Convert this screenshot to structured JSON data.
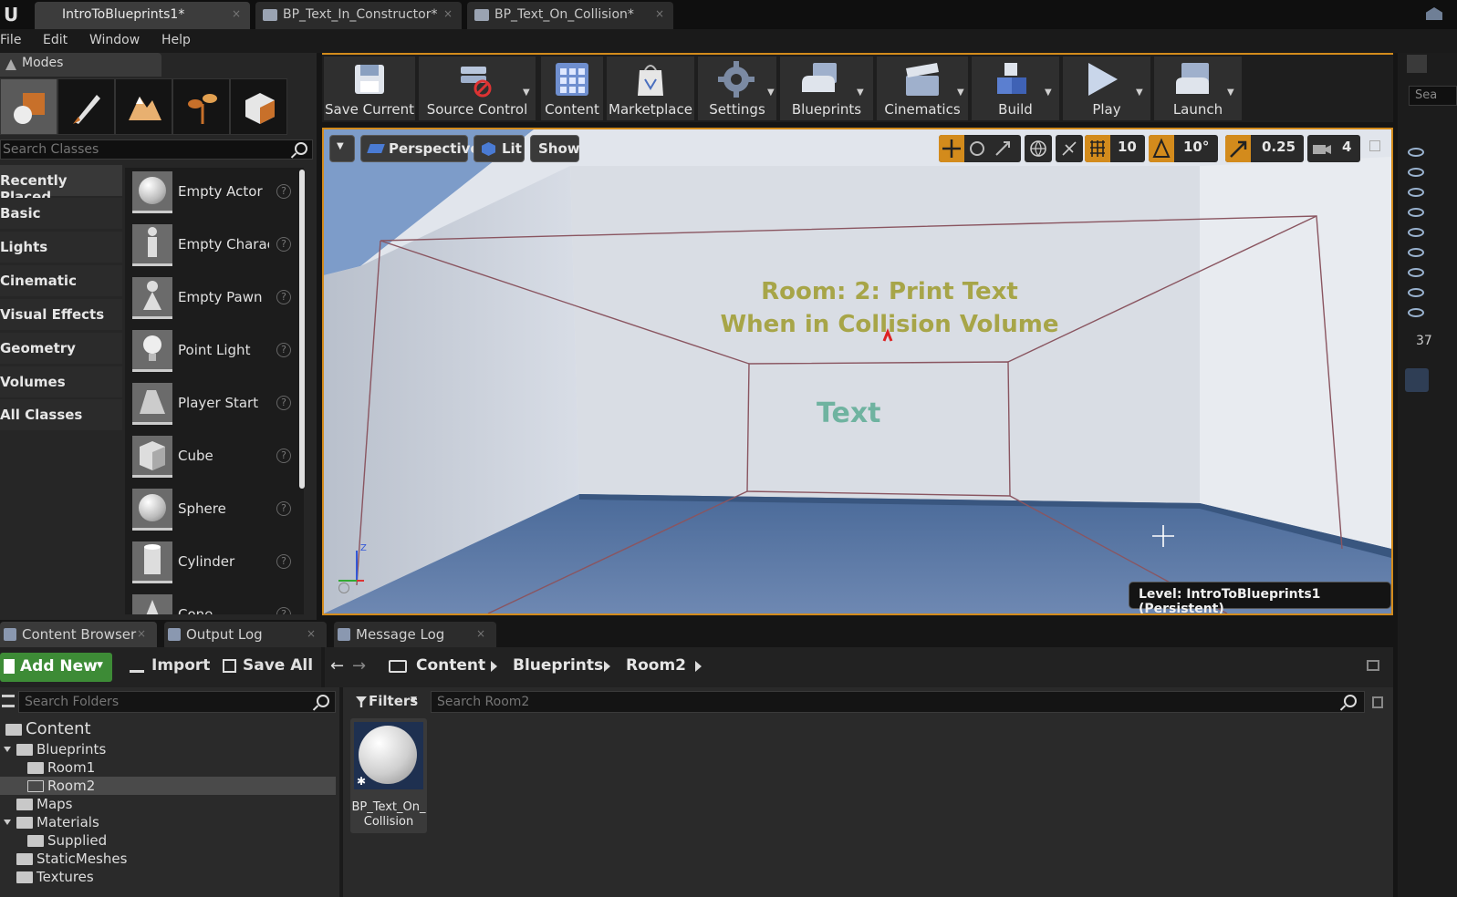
{
  "window": {
    "tabs": [
      {
        "label": "IntroToBlueprints1*"
      },
      {
        "label": "BP_Text_In_Constructor*"
      },
      {
        "label": "BP_Text_On_Collision*"
      }
    ]
  },
  "menu": [
    "File",
    "Edit",
    "Window",
    "Help"
  ],
  "modes": {
    "tab_label": "Modes",
    "search_placeholder": "Search Classes",
    "categories": [
      "Recently Placed",
      "Basic",
      "Lights",
      "Cinematic",
      "Visual Effects",
      "Geometry",
      "Volumes",
      "All Classes"
    ],
    "items": [
      "Empty Actor",
      "Empty Charac",
      "Empty Pawn",
      "Point Light",
      "Player Start",
      "Cube",
      "Sphere",
      "Cylinder",
      "Cone"
    ]
  },
  "toolbar": {
    "buttons": [
      "Save Current",
      "Source Control",
      "Content",
      "Marketplace",
      "Settings",
      "Blueprints",
      "Cinematics",
      "Build",
      "Play",
      "Launch"
    ]
  },
  "viewport": {
    "perspective": "Perspective",
    "lit": "Lit",
    "show": "Show",
    "grid_snap": "10",
    "rotation_snap": "10°",
    "scale_snap": "0.25",
    "camera_speed": "4",
    "room_text_line1": "Room: 2: Print Text",
    "room_text_line2": "When in Collision Volume",
    "text_actor": "Text",
    "level_label": "Level:  IntroToBlueprints1 (Persistent)"
  },
  "right_strip": {
    "search_stub": "Sea",
    "count_stub": "37"
  },
  "bottom_tabs": [
    "Content Browser",
    "Output Log",
    "Message Log"
  ],
  "content_browser": {
    "add_new": "Add New",
    "import": "Import",
    "save_all": "Save All",
    "breadcrumb": [
      "Content",
      "Blueprints",
      "Room2"
    ],
    "folder_search_placeholder": "Search Folders",
    "filters": "Filters",
    "asset_search_placeholder": "Search Room2",
    "tree": [
      "Content",
      "Blueprints",
      "Room1",
      "Room2",
      "Maps",
      "Materials",
      "Supplied",
      "StaticMeshes",
      "Textures"
    ],
    "asset_label": "BP_Text_On_\nCollision"
  },
  "colors": {
    "accent": "#d38b1c",
    "add_new_green": "#3d8b36",
    "room_text": "#a7a548",
    "text_actor": "#6fb3a0"
  }
}
